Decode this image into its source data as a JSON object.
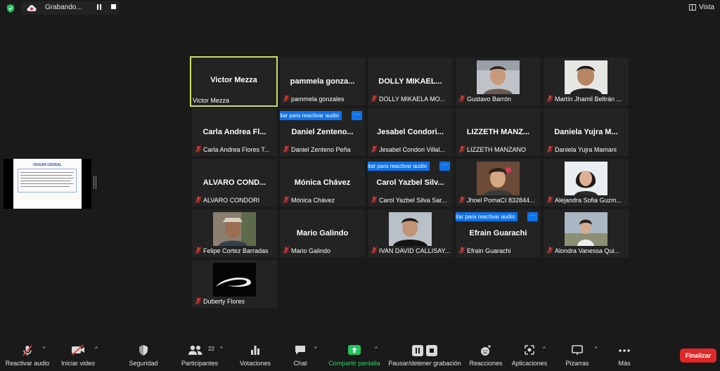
{
  "topbar": {
    "recording_label": "Grabando...",
    "view_label": "Vista"
  },
  "shared_content": {
    "title": "HOGAR CENSAL"
  },
  "tiles": [
    {
      "name": "Victor Mezza",
      "label": "Victor Mezza",
      "muted": false,
      "active": true,
      "photo": null,
      "unmute_banner": false
    },
    {
      "name": "pammela  gonza...",
      "label": "pammela gonzales",
      "muted": true,
      "photo": null,
      "unmute_banner": false
    },
    {
      "name": "DOLLY  MIKAEL...",
      "label": "DOLLY MIKAELA MO...",
      "muted": true,
      "photo": null,
      "unmute_banner": false
    },
    {
      "name": "",
      "label": "Gustavo Barrón",
      "muted": true,
      "photo": "face-a",
      "unmute_banner": false
    },
    {
      "name": "",
      "label": "Martín Jhamil Beltrán ...",
      "muted": true,
      "photo": "face-b",
      "unmute_banner": false
    },
    {
      "name": "Carla  Andrea  Fl...",
      "label": "Carla Andrea Flores T...",
      "muted": true,
      "photo": null,
      "unmute_banner": false
    },
    {
      "name": "Daniel  Zenteno...",
      "label": "Daniel Zenteno Peña",
      "muted": true,
      "photo": null,
      "unmute_banner": true
    },
    {
      "name": "Jesabel  Condori...",
      "label": "Jesabel Condori Villal...",
      "muted": true,
      "photo": null,
      "unmute_banner": false
    },
    {
      "name": "LIZZETH  MANZ...",
      "label": "LIZZETH MANZANO",
      "muted": true,
      "photo": null,
      "unmute_banner": false
    },
    {
      "name": "Daniela  Yujra  M...",
      "label": "Daniela Yujra Mamani",
      "muted": true,
      "photo": null,
      "unmute_banner": false
    },
    {
      "name": "ALVARO  COND...",
      "label": "ALVARO CONDORI",
      "muted": true,
      "photo": null,
      "unmute_banner": false
    },
    {
      "name": "Mónica  Chávez",
      "label": "Mónica Chávez",
      "muted": true,
      "photo": null,
      "unmute_banner": false
    },
    {
      "name": "Carol  Yazbel  Silv...",
      "label": "Carol Yazbel Silva Sar...",
      "muted": true,
      "photo": null,
      "unmute_banner": true
    },
    {
      "name": "",
      "label": "Jhoel PomaCI 832844...",
      "muted": true,
      "photo": "face-c",
      "unmute_banner": false
    },
    {
      "name": "",
      "label": "Alejandra Sofia Guzm...",
      "muted": true,
      "photo": "face-d",
      "unmute_banner": false
    },
    {
      "name": "",
      "label": "Felipe Cortez Barradas",
      "muted": true,
      "photo": "face-e",
      "unmute_banner": false
    },
    {
      "name": "Mario  Galindo",
      "label": "Mario Galindo",
      "muted": true,
      "photo": null,
      "unmute_banner": false
    },
    {
      "name": "",
      "label": "IVAN DAVID CALLISAY...",
      "muted": true,
      "photo": "face-f",
      "unmute_banner": false
    },
    {
      "name": "Efrain  Guarachi",
      "label": "Efrain Guarachi",
      "muted": true,
      "photo": null,
      "unmute_banner": true
    },
    {
      "name": "",
      "label": "Alondra Vanessa Qui...",
      "muted": true,
      "photo": "face-g",
      "unmute_banner": false
    },
    {
      "name": "",
      "label": "Duberty Flores",
      "muted": true,
      "photo": "logo",
      "unmute_banner": false
    }
  ],
  "unmute_banner_text": "itar para reactivar audio",
  "more_text": "···",
  "toolbar": {
    "audio": "Reactivar audio",
    "video": "Iniciar video",
    "security": "Seguridad",
    "participants": "Participantes",
    "participants_count": "22",
    "polls": "Votaciones",
    "chat": "Chat",
    "share": "Compartir pantalla",
    "record": "Pausar/detener grabación",
    "reactions": "Reacciones",
    "apps": "Aplicaciones",
    "whiteboards": "Pizarras",
    "more": "Más",
    "end": "Finalizar"
  },
  "colors": {
    "background": "#1a1a1a",
    "tile": "#232323",
    "active_border": "#c7e06a",
    "share_green": "#22c55e",
    "end_red": "#e02828",
    "mute_red": "#e03a3a",
    "banner_blue": "#0e72ed"
  }
}
